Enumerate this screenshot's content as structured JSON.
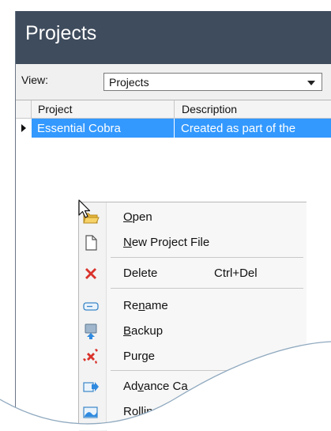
{
  "window": {
    "title": "Projects"
  },
  "view": {
    "label": "View:",
    "selected": "Projects"
  },
  "grid": {
    "columns": [
      "Project",
      "Description"
    ],
    "rows": [
      {
        "project": "Essential Cobra",
        "description": "Created as part of the"
      }
    ]
  },
  "context_menu": {
    "open": {
      "pre": "",
      "accel": "O",
      "post": "pen"
    },
    "new_project_file": {
      "pre": "",
      "accel": "N",
      "post": "ew Project File"
    },
    "delete": {
      "label": "Delete",
      "shortcut": "Ctrl+Del"
    },
    "rename": {
      "pre": "Re",
      "accel": "n",
      "post": "ame"
    },
    "backup": {
      "pre": "",
      "accel": "B",
      "post": "ackup"
    },
    "purge": {
      "label": "Purge"
    },
    "advance_calc": {
      "pre": "Ad",
      "accel": "v",
      "post": "ance Ca"
    },
    "rolling": {
      "label": "Rollin"
    }
  },
  "colors": {
    "titlebar": "#3f4c5d",
    "selection": "#3399ff",
    "delete_icon": "#d9322b"
  }
}
